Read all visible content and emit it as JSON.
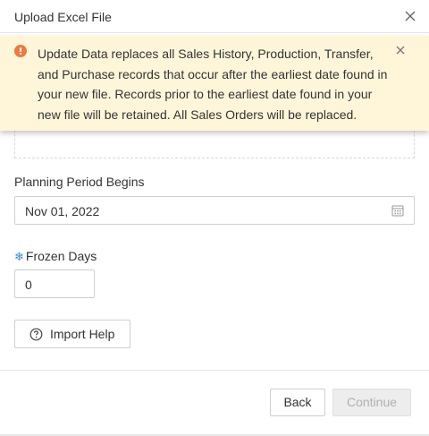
{
  "dialog": {
    "title": "Upload Excel File",
    "close_icon": "close-icon"
  },
  "alert": {
    "icon": "warning-circle-icon",
    "color": "#e97b3f",
    "background": "#fff6da",
    "message": "Update Data replaces all Sales History, Production, Transfer, and Purchase records that occur after the earliest date found in your new file. Records prior to the earliest date found in your new file will be retained. All Sales Orders will be replaced.",
    "close_icon": "close-icon"
  },
  "planning_period": {
    "label": "Planning Period Begins",
    "value": "Nov 01, 2022",
    "icon": "calendar-icon"
  },
  "frozen_days": {
    "icon": "snowflake-icon",
    "icon_glyph": "❄",
    "label": "Frozen Days",
    "value": "0"
  },
  "import_help": {
    "icon": "question-circle-icon",
    "label": "Import Help"
  },
  "footer": {
    "back_label": "Back",
    "continue_label": "Continue",
    "continue_disabled": true
  }
}
